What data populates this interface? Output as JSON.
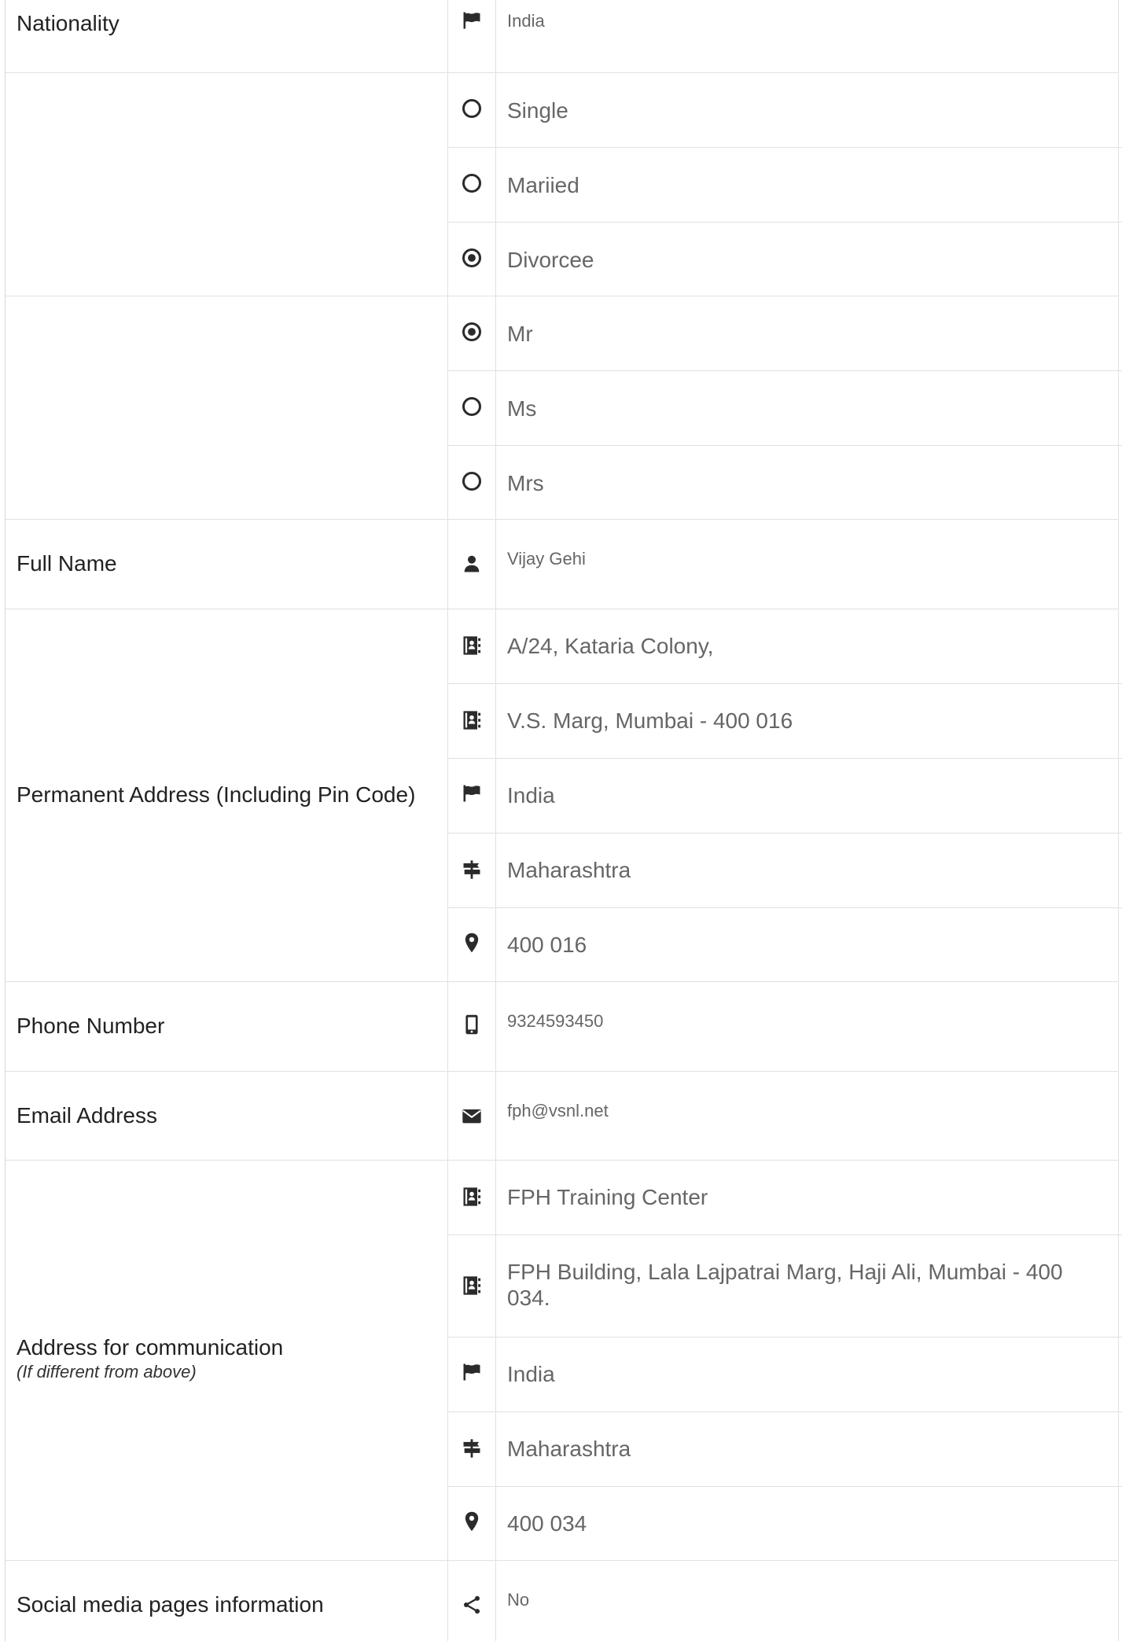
{
  "nationality": {
    "label": "Nationality",
    "value": "India",
    "icon": "flag-icon"
  },
  "marital_status": {
    "options": [
      {
        "label": "Single",
        "selected": false
      },
      {
        "label": "Mariied",
        "selected": false
      },
      {
        "label": "Divorcee",
        "selected": true
      }
    ]
  },
  "title": {
    "options": [
      {
        "label": "Mr",
        "selected": true
      },
      {
        "label": "Ms",
        "selected": false
      },
      {
        "label": "Mrs",
        "selected": false
      }
    ]
  },
  "full_name": {
    "label": "Full Name",
    "value": "Vijay Gehi",
    "icon": "user-icon"
  },
  "permanent_address": {
    "label": "Permanent Address (Including Pin Code)",
    "line1": "A/24, Kataria Colony,",
    "line2": "V.S. Marg, Mumbai - 400 016",
    "country": "India",
    "state": "Maharashtra",
    "pin": "400 016"
  },
  "phone": {
    "label": "Phone Number",
    "value": "9324593450",
    "icon": "mobile-icon"
  },
  "email": {
    "label": "Email Address",
    "value": "fph@vsnl.net",
    "icon": "envelope-icon"
  },
  "comm_address": {
    "label": "Address for communication",
    "sublabel": "(If different from above)",
    "line1": "FPH Training Center",
    "line2": "FPH Building, Lala Lajpatrai Marg, Haji Ali, Mumbai - 400 034.",
    "country": "India",
    "state": "Maharashtra",
    "pin": "400 034"
  },
  "social_media": {
    "label": "Social media pages information",
    "value": "No",
    "icon": "share-icon"
  },
  "colors": {
    "text": "#212121",
    "value_text": "#666666",
    "border": "#e1e1e1",
    "icon": "#2b2b2b"
  }
}
